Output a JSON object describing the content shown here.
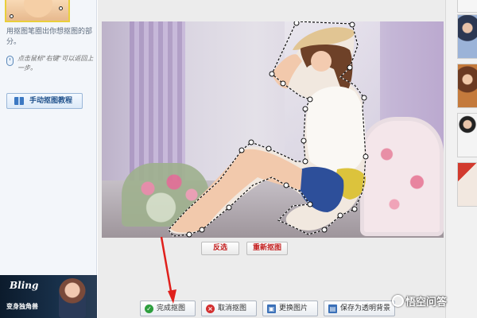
{
  "left_panel": {
    "hint": "用抠图笔圈出你想抠图的部分。",
    "tip": "点击鼠标\"右键\"可以返回上一步。",
    "tutorial_button": "手动抠图教程",
    "ad": {
      "brand": "Bling",
      "slogan": "变身独角兽"
    }
  },
  "canvas": {
    "buttons": {
      "invert": "反选",
      "reselect": "重新抠图"
    }
  },
  "action_bar": {
    "finish": "完成抠图",
    "cancel": "取消抠图",
    "replace": "更换图片",
    "save": "保存为透明背景"
  },
  "watermark": {
    "text": "悟空问答"
  },
  "colors": {
    "accent_red": "#c31d1d",
    "arrow_red": "#e0201c",
    "finish_green": "#2d9e3e"
  }
}
